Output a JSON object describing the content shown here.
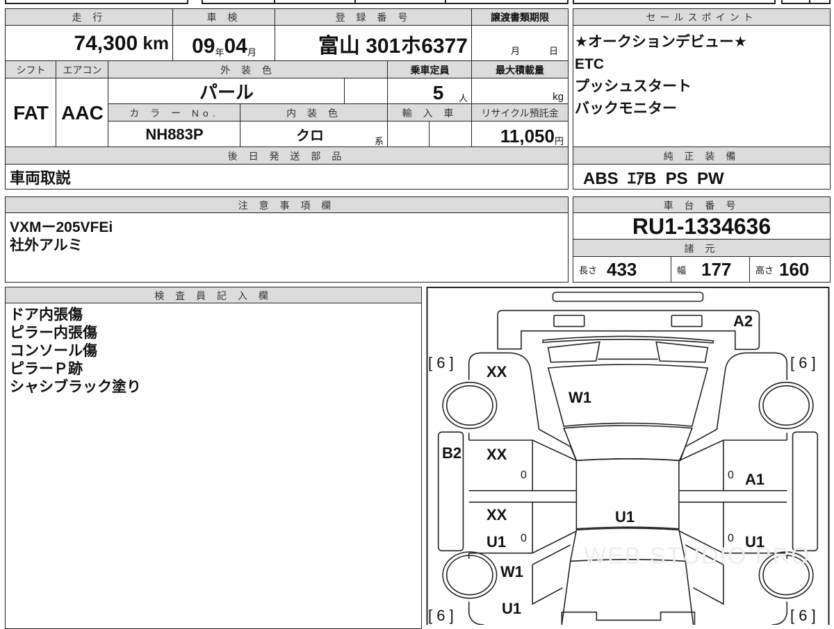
{
  "left_table": {
    "mileage_header": "走 行",
    "mileage_value": "74,300",
    "mileage_unit": "km",
    "inspection_header": "車 検",
    "inspection_year": "09",
    "year_unit": "年",
    "inspection_month": "04",
    "month_unit": "月",
    "registration_header": "登 録 番 号",
    "registration_value": "富山 301ホ6377",
    "transfer_deadline_header": "譲渡書類期限",
    "transfer_month_unit": "月",
    "transfer_day_unit": "日",
    "shift_header": "シフト",
    "shift_value": "FAT",
    "aircon_header": "エアコン",
    "aircon_value": "AAC",
    "exterior_color_header": "外 装 色",
    "exterior_color_value": "パール",
    "capacity_header": "乗車定員",
    "capacity_value": "5",
    "capacity_unit": "人",
    "max_load_header": "最大積載量",
    "max_load_unit": "kg",
    "color_no_header": "カ ラ ー No.",
    "color_no_value": "NH883P",
    "interior_color_header": "内 装 色",
    "interior_color_value": "クロ",
    "interior_color_suffix": "系",
    "import_header": "輸 入 車",
    "recycle_header": "リサイクル預託金",
    "recycle_value": "11,050",
    "recycle_unit": "円",
    "later_parts_header": "後 日 発 送 部 品",
    "later_parts_value": "車両取説"
  },
  "sales_points": {
    "header": "セールスポイント",
    "items": [
      "★オークションデビュー★",
      "ETC",
      "プッシュスタート",
      "バックモニター"
    ]
  },
  "standard_equipment": {
    "header": "純 正 装 備",
    "value": "ABS  ｴｱB  PS  PW"
  },
  "notes": {
    "header": "注 意 事 項 欄",
    "lines": [
      "VXMー205VFEi",
      "社外アルミ"
    ]
  },
  "chassis": {
    "header": "車 台 番 号",
    "value": "RU1-1334636",
    "specs_header": "諸 元",
    "length_label": "長さ",
    "length_value": "433",
    "width_label": "幅",
    "width_value": "177",
    "height_label": "高さ",
    "height_value": "160"
  },
  "inspector": {
    "header": "検 査 員 記 入 欄",
    "lines": [
      "ドア内張傷",
      "ピラー内張傷",
      "コンソール傷",
      "ピラーＰ跡",
      "シャシブラック塗り"
    ]
  },
  "diagram": {
    "tire_front_left": "[ 6 ]",
    "tire_front_right": "[ 6 ]",
    "tire_rear_left": "[ 6 ]",
    "tire_rear_right": "[ 6 ]",
    "front_bumper": "A2",
    "front_left_fender": "XX",
    "windshield": "W1",
    "left_sill": "B2",
    "front_left_door": "XX",
    "front_left_door_zero": "0",
    "front_right_door_zero": "0",
    "front_right_door": "A1",
    "rear_left_door": "XX",
    "rear_left_door_2": "U1",
    "rear_left_door_zero": "0",
    "roof": "U1",
    "rear_right_door_zero": "0",
    "rear_right_door": "U1",
    "rear_left_window": "W1",
    "rear_left_quarter": "U1",
    "watermark": "WEB STUDIO PRO"
  }
}
